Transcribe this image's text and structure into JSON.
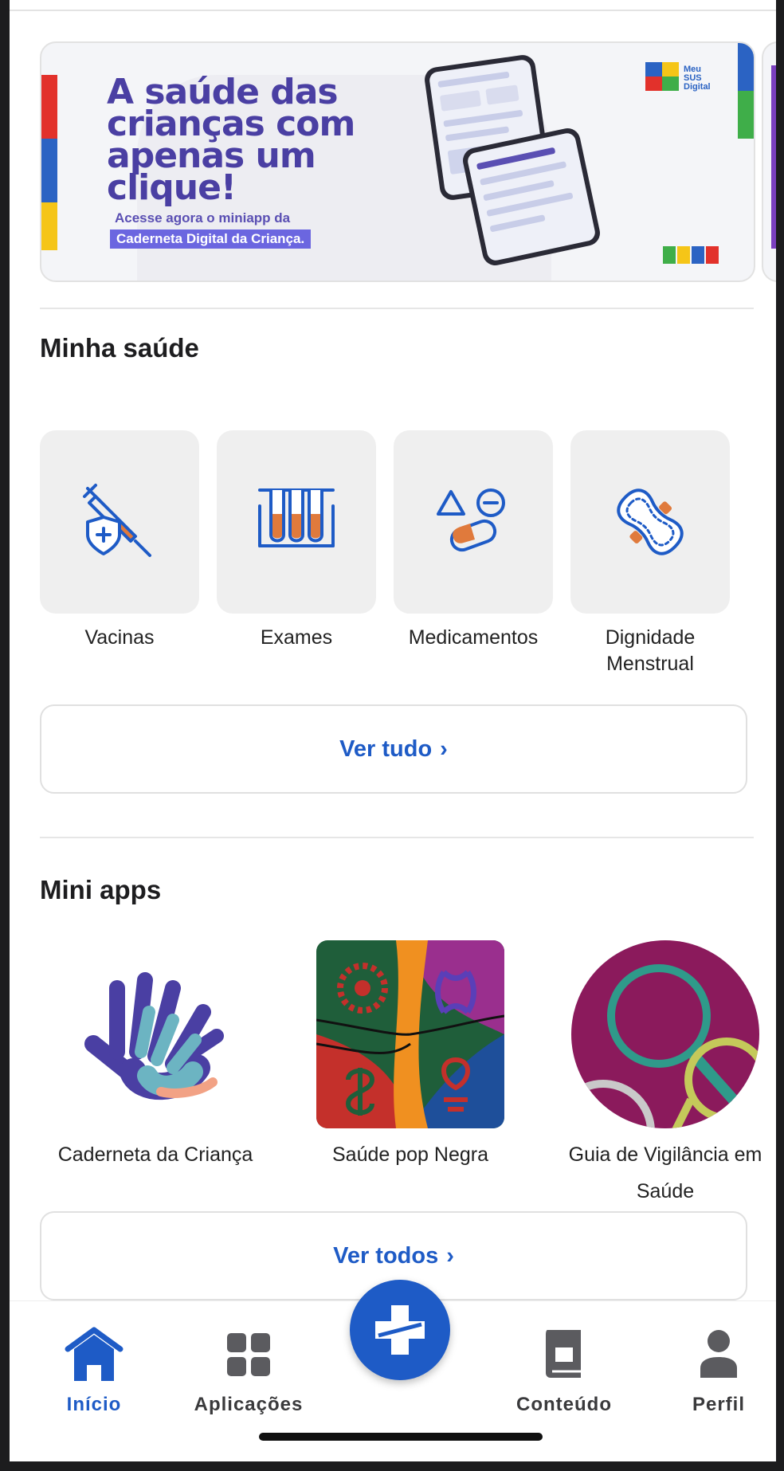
{
  "banner": {
    "title": "A saúde das crianças com apenas um clique!",
    "subtitle_line1": "Acesse agora o miniapp da",
    "subtitle_line2": "Caderneta Digital da Criança.",
    "logo_text": "Meu SUS Digital"
  },
  "minha_saude": {
    "title": "Minha saúde",
    "items": [
      {
        "label": "Vacinas",
        "icon": "vaccine-icon"
      },
      {
        "label": "Exames",
        "icon": "test-tubes-icon"
      },
      {
        "label": "Medicamentos",
        "icon": "medications-icon"
      },
      {
        "label": "Dignidade Menstrual",
        "icon": "sanitary-pad-icon"
      }
    ],
    "see_all": "Ver tudo"
  },
  "mini_apps": {
    "title": "Mini apps",
    "items": [
      {
        "label": "Caderneta da Criança",
        "icon": "hands-icon"
      },
      {
        "label": "Saúde pop Negra",
        "icon": "adinkra-pattern-icon"
      },
      {
        "label": "Guia de Vigilância em Saúde",
        "icon": "magnifier-circle-icon"
      }
    ],
    "see_all": "Ver todos"
  },
  "nav": {
    "items": [
      {
        "label": "Início",
        "icon": "home-icon",
        "active": true
      },
      {
        "label": "Aplicações",
        "icon": "grid-icon",
        "active": false
      },
      {
        "label": "Conteúdo",
        "icon": "book-icon",
        "active": false
      },
      {
        "label": "Perfil",
        "icon": "person-icon",
        "active": false
      }
    ],
    "center_button_icon": "sus-cross-icon"
  },
  "colors": {
    "primary": "#1e5bc6",
    "banner_purple": "#4a3fa3",
    "icon_orange": "#e07a3c"
  }
}
